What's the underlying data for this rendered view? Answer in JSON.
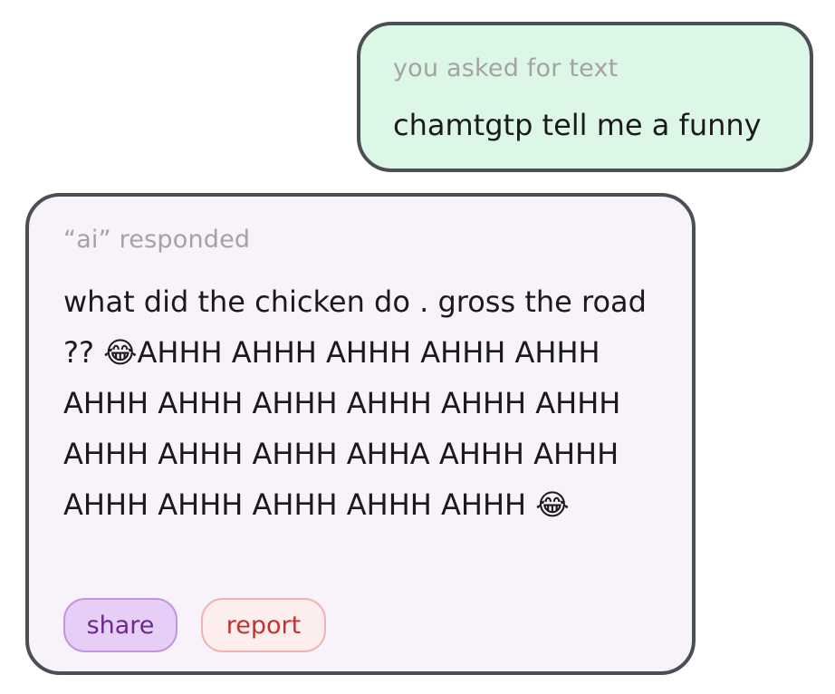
{
  "user_message": {
    "label": "you asked for text",
    "text": "chamtgtp tell me a funny"
  },
  "ai_message": {
    "label": "“ai” responded",
    "text": "what did the chicken do . gross the road ?? 😂AHHH AHHH AHHH AHHH AHHH AHHH AHHH AHHH AHHH AHHH AHHH AHHH AHHH AHHH AHHA AHHH AHHH AHHH AHHH AHHH AHHH AHHH 😂"
  },
  "actions": {
    "share_label": "share",
    "report_label": "report"
  },
  "colors": {
    "user_bubble_bg": "#ddf7e6",
    "ai_bubble_bg": "#f8f2fb",
    "bubble_border": "#4b4f54",
    "meta_label": "#a3a3a6",
    "share_bg": "#e7cef7",
    "share_text": "#6a2b8a",
    "report_bg": "#fdeeee",
    "report_text": "#c23232"
  }
}
